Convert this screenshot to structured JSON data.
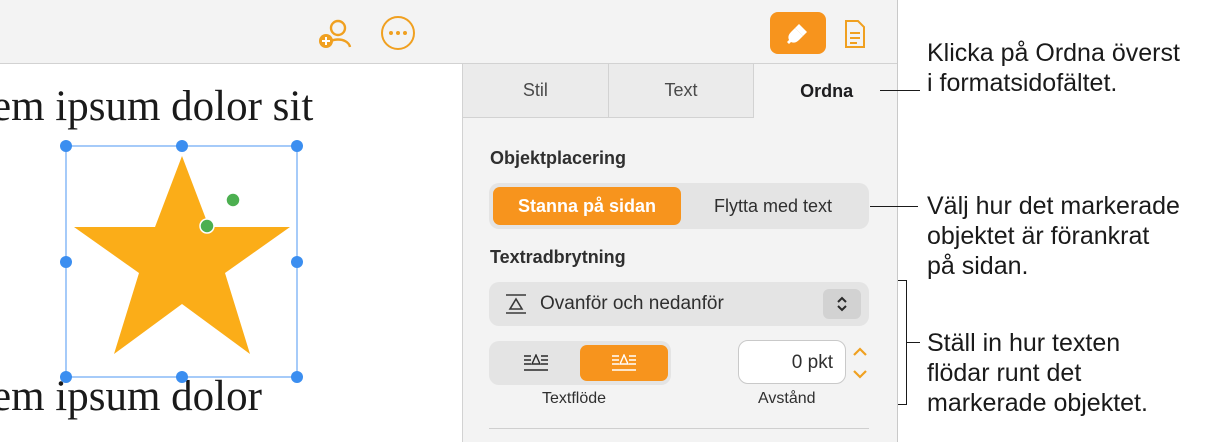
{
  "document": {
    "line1": "em ipsum dolor sit",
    "line2": "em ipsum dolor"
  },
  "toolbar": {
    "icons": [
      "collaborate-icon",
      "more-icon",
      "format-paintbrush-icon",
      "document-icon"
    ]
  },
  "sidebar": {
    "tabs": [
      {
        "label": "Stil"
      },
      {
        "label": "Text"
      },
      {
        "label": "Ordna"
      }
    ],
    "active_tab": "Ordna",
    "placement": {
      "heading": "Objektplacering",
      "options": [
        "Stanna på sidan",
        "Flytta med text"
      ],
      "selected": "Stanna på sidan"
    },
    "wrap": {
      "heading": "Textradbrytning",
      "value": "Ovanför och nedanför",
      "flow_label": "Textflöde",
      "spacing_label": "Avstånd",
      "spacing_value": "0 pkt"
    }
  },
  "callouts": {
    "c1": "Klicka på Ordna överst\ni formatsidofältet.",
    "c2": "Välj hur det markerade\nobjektet är förankrat\npå sidan.",
    "c3": "Ställ in hur texten\nflödar runt det\nmarkerade objektet."
  },
  "colors": {
    "accent": "#f7941d",
    "star": "#fbad18",
    "selection": "#1a73e8",
    "handle": "#3b8ef0"
  }
}
